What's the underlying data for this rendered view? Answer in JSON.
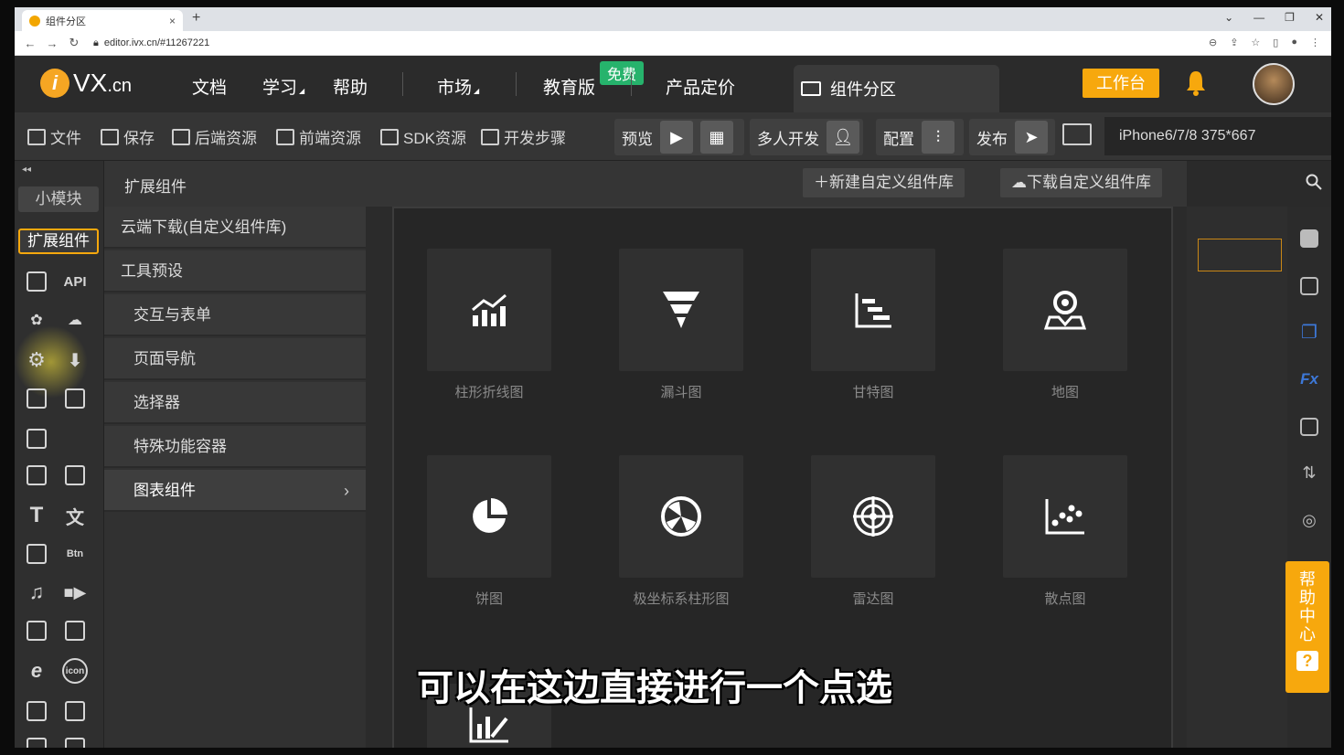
{
  "browser": {
    "tab_title": "组件分区",
    "tab_close": "×",
    "new_tab": "+",
    "url": "editor.ivx.cn/#11267221",
    "window_controls": [
      "⌄",
      "—",
      "❐",
      "✕"
    ]
  },
  "header": {
    "logo_prefix": "i",
    "logo_main": "VX",
    "logo_suffix": ".cn",
    "nav": [
      "文档",
      "学习",
      "帮助",
      "市场",
      "教育版",
      "产品定价"
    ],
    "free_badge": "免费",
    "zone_tab": "组件分区",
    "workbench": "工作台"
  },
  "toolbar": {
    "items": [
      "文件",
      "保存",
      "后端资源",
      "前端资源",
      "SDK资源",
      "开发步骤"
    ],
    "preview": "预览",
    "multi_dev": "多人开发",
    "config": "配置",
    "publish": "发布",
    "device": "iPhone6/7/8 375*667"
  },
  "left_panel": {
    "collapse": "◂◂",
    "btn_small_module": "小模块",
    "btn_extension": "扩展组件",
    "api_label": "API",
    "btn_label": "Btn",
    "icon_label": "icon"
  },
  "category": {
    "title": "扩展组件",
    "new_lib": "新建自定义组件库",
    "download_lib": "下载自定义组件库",
    "items": [
      "云端下载(自定义组件库)",
      "工具预设",
      "交互与表单",
      "页面导航",
      "选择器",
      "特殊功能容器",
      "图表组件"
    ],
    "chevron": "›"
  },
  "cards": [
    "柱形折线图",
    "漏斗图",
    "甘特图",
    "地图",
    "饼图",
    "极坐标系柱形图",
    "雷达图",
    "散点图"
  ],
  "help_center": {
    "chars": [
      "帮",
      "助",
      "中",
      "心"
    ],
    "q": "?"
  },
  "subtitle": "可以在这边直接进行一个点选",
  "colors": {
    "accent": "#f7a80d",
    "free_badge": "#26b36c",
    "background": "#2b2b2b"
  }
}
